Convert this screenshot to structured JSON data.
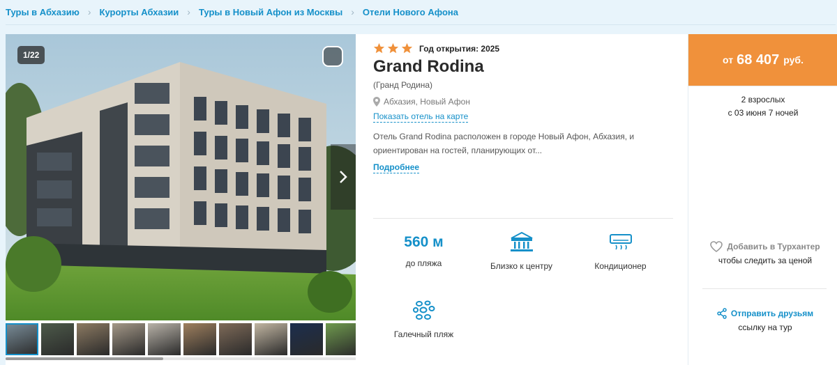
{
  "breadcrumbs": [
    "Туры в Абхазию",
    "Курорты Абхазии",
    "Туры в Новый Афон из Москвы",
    "Отели Нового Афона"
  ],
  "gallery": {
    "counter": "1/22",
    "thumb_colors": [
      "#7a8e9a",
      "#4d5a4a",
      "#8c7a62",
      "#a49888",
      "#b8b2a8",
      "#9e7f5e",
      "#7e6a58",
      "#c2b6a2",
      "#1c2e4e",
      "#6f9a4e"
    ]
  },
  "hotel": {
    "stars": 3,
    "opened": "Год открытия: 2025",
    "name": "Grand Rodina",
    "alt_name": "(Гранд Родина)",
    "location": "Абхазия, Новый Афон",
    "map_link": "Показать отель на карте",
    "description_line1": "Отель Grand Rodina расположен в городе Новый Афон, Абхазия, и",
    "description_line2": "ориентирован на гостей, планирующих от...",
    "more_link": "Подробнее"
  },
  "features": {
    "beach_distance": "560 м",
    "beach_label": "до пляжа",
    "center_label": "Близко к центру",
    "ac_label": "Кондиционер",
    "pebble_label": "Галечный пляж"
  },
  "price": {
    "from": "от",
    "amount": "68 407",
    "currency": "руб.",
    "guests": "2 взрослых",
    "dates": "с 03 июня 7 ночей"
  },
  "actions": {
    "add_title": "Добавить в Турхантер",
    "add_sub": "чтобы следить за ценой",
    "share_title": "Отправить друзьям",
    "share_sub": "ссылку на тур"
  },
  "colors": {
    "accent": "#1590c9",
    "price_bg": "#f0913b",
    "star": "#f0913b"
  },
  "icons": [
    "chevron-right-icon",
    "favorite-icon",
    "map-pin-icon",
    "star-icon",
    "building-center-icon",
    "air-conditioner-icon",
    "pebbles-icon",
    "heart-icon",
    "share-icon"
  ]
}
